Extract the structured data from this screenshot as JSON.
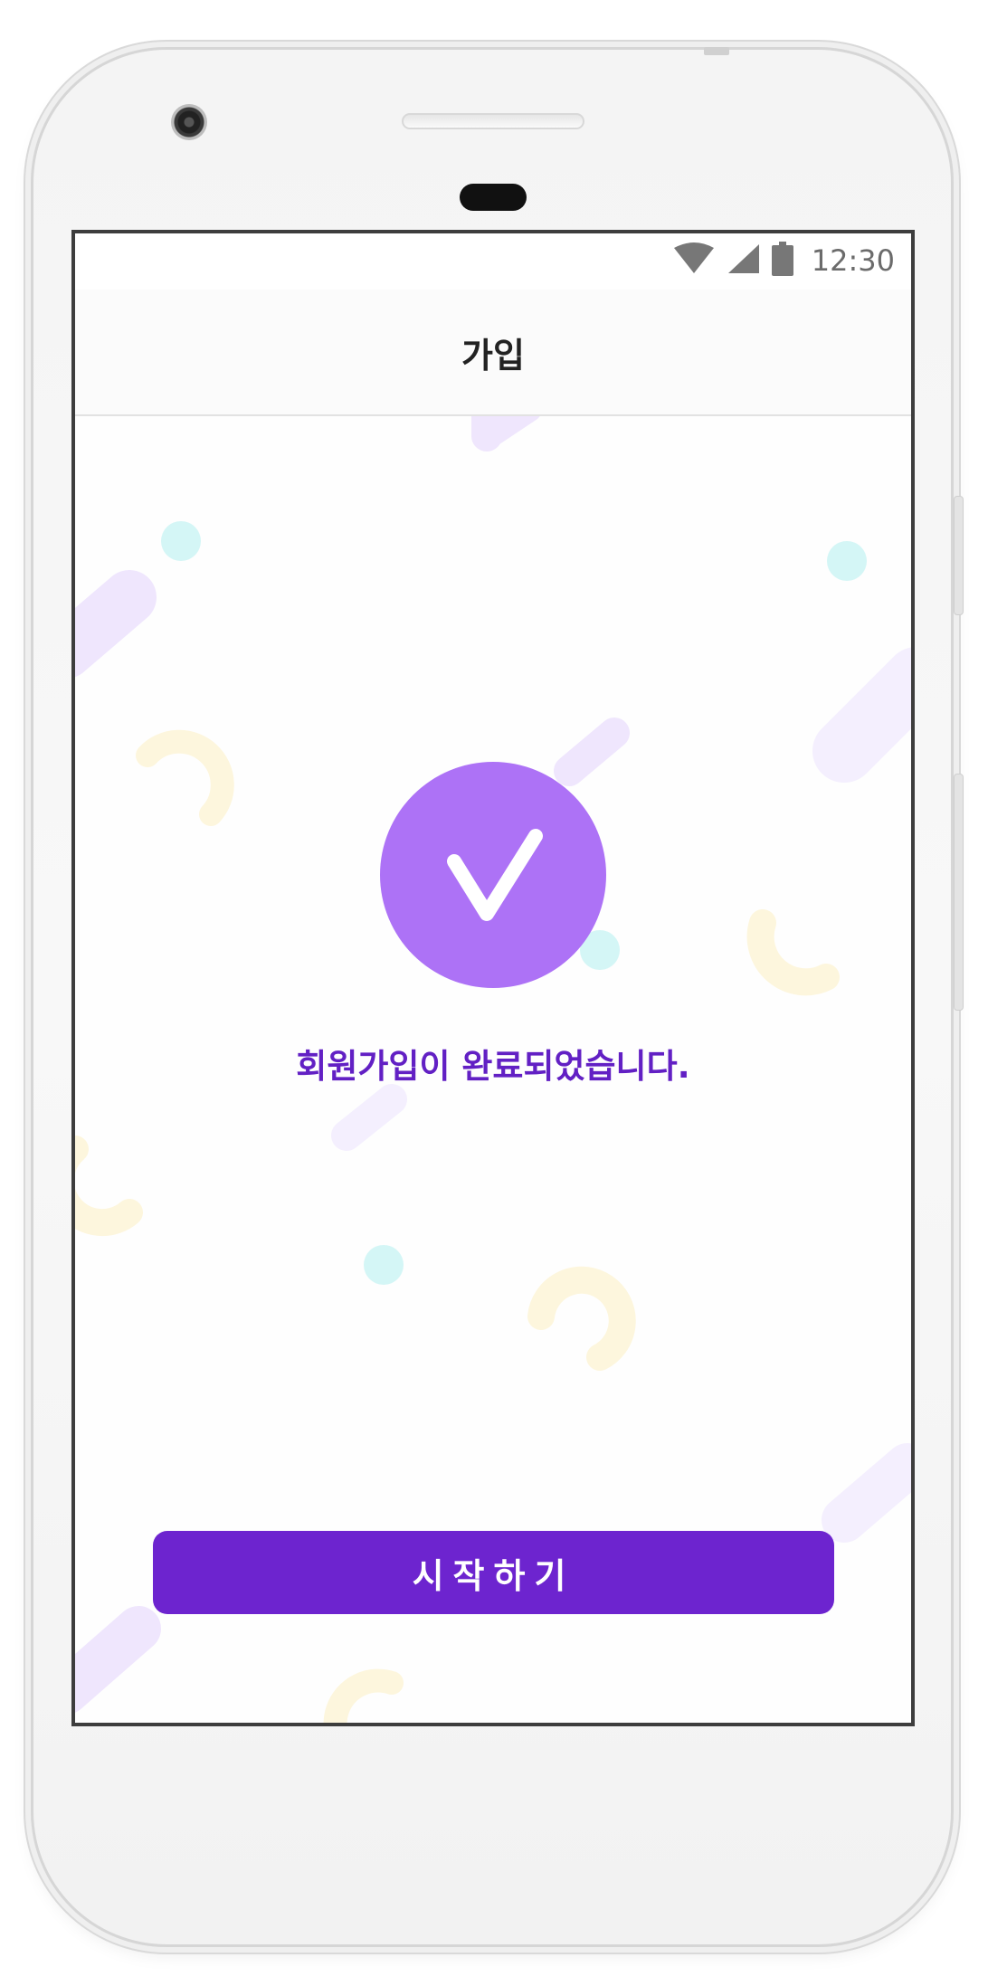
{
  "status_bar": {
    "time": "12:30",
    "icons": [
      "wifi-icon",
      "signal-icon",
      "battery-icon"
    ]
  },
  "header": {
    "title": "가입"
  },
  "main": {
    "success_icon": "check-icon",
    "message": "회원가입이 완료되었습니다.",
    "start_label": "시작하기"
  },
  "colors": {
    "accent": "#6d24cf",
    "check_circle": "#ad72f6",
    "message_text": "#6220c4"
  }
}
